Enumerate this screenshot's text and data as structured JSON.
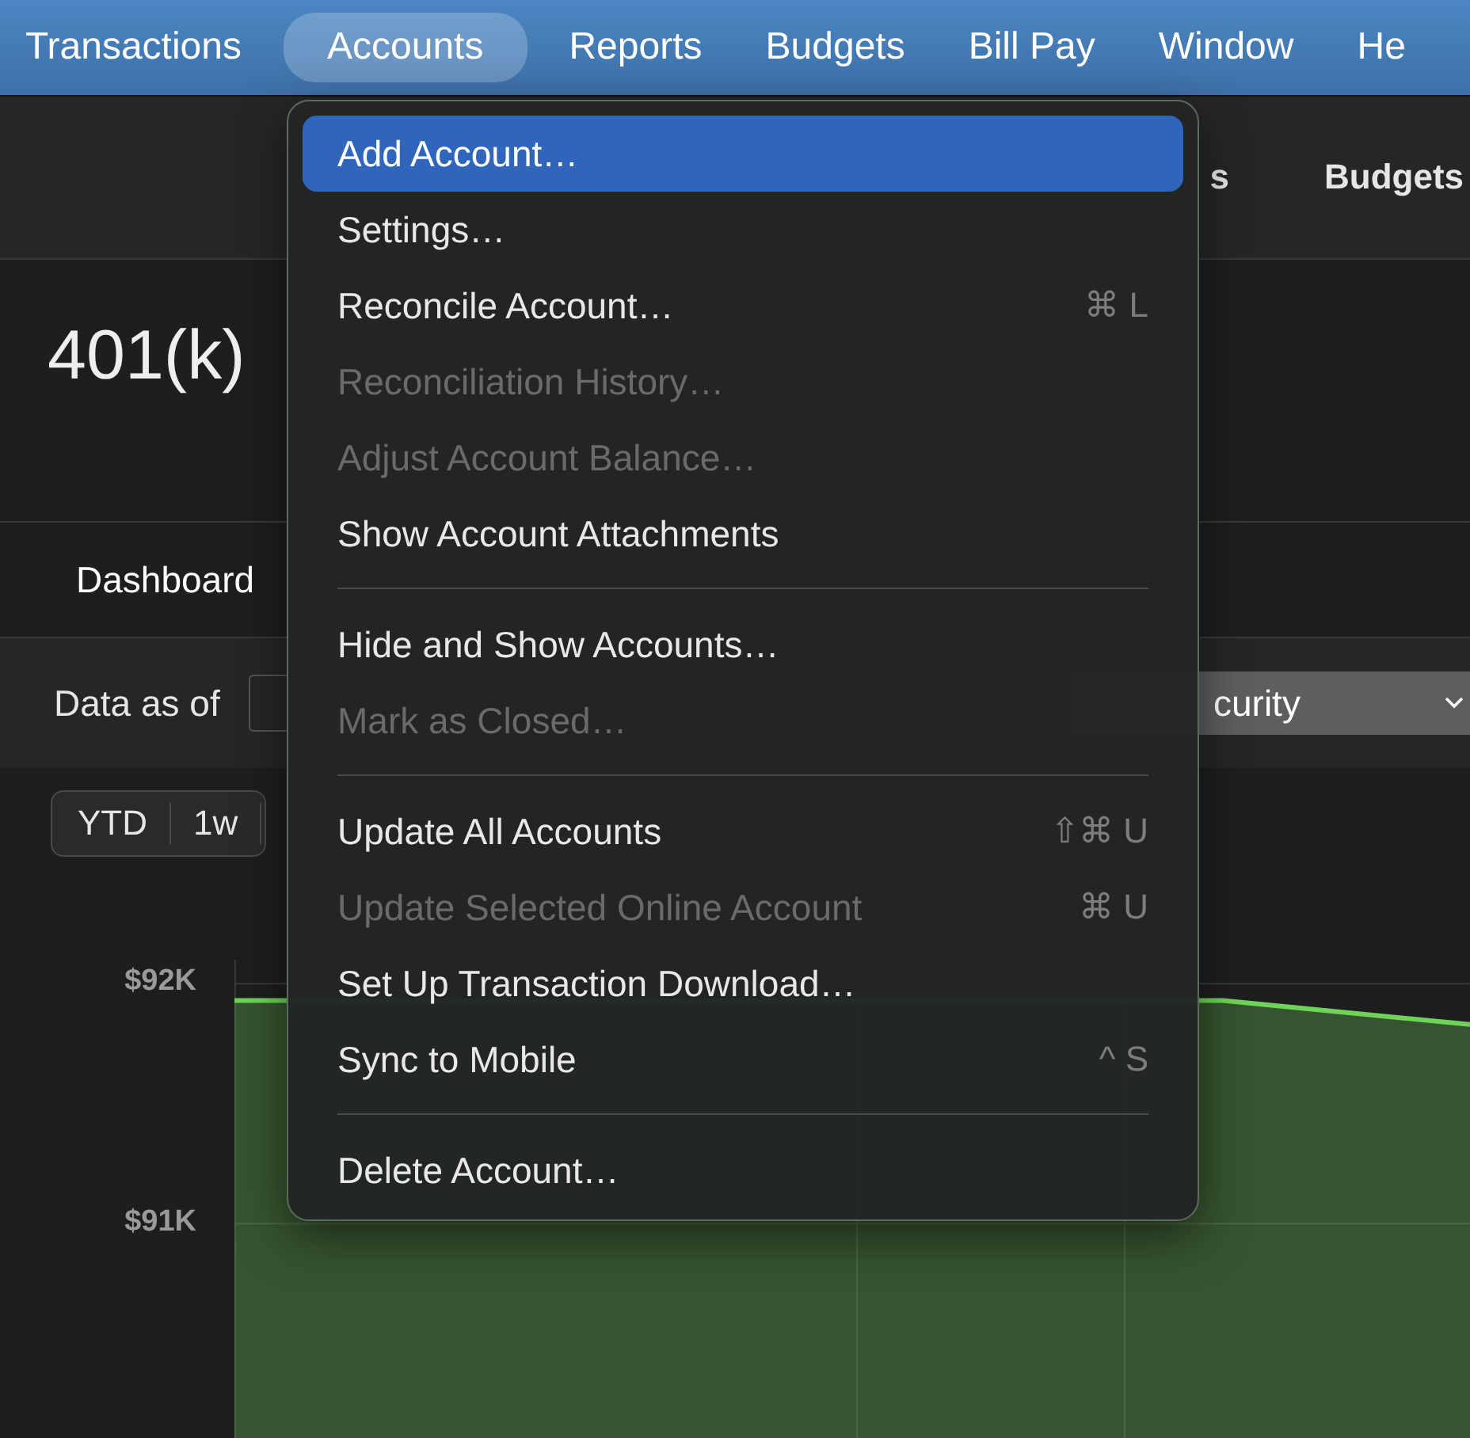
{
  "menu_bar": {
    "items": [
      {
        "label": "Transactions",
        "selected": false
      },
      {
        "label": "Accounts",
        "selected": true
      },
      {
        "label": "Reports",
        "selected": false
      },
      {
        "label": "Budgets",
        "selected": false
      },
      {
        "label": "Bill Pay",
        "selected": false
      },
      {
        "label": "Window",
        "selected": false
      },
      {
        "label": "He",
        "selected": false
      }
    ]
  },
  "toolbar": {
    "items": [
      "s",
      "Budgets"
    ]
  },
  "account": {
    "title": "401(k)"
  },
  "tabs": [
    {
      "label": "Dashboard",
      "selected": true
    }
  ],
  "filter": {
    "label": "Data as of",
    "popup": "curity"
  },
  "range_buttons": [
    {
      "label": "YTD",
      "selected": false
    },
    {
      "label": "1w",
      "selected": false
    }
  ],
  "chart": {
    "chart_data": {
      "type": "area",
      "yticks": [
        {
          "value": 92000,
          "label": "$92K"
        },
        {
          "value": 91000,
          "label": "$91K"
        }
      ],
      "ylim": [
        90100,
        92100
      ],
      "series": [
        {
          "color": "#6fd35a",
          "values": [
            91930,
            null,
            null,
            null,
            91930,
            91830
          ]
        }
      ]
    }
  },
  "menu": {
    "items": [
      {
        "kind": "item",
        "label": "Add Account…",
        "disabled": false,
        "selected": true
      },
      {
        "kind": "item",
        "label": "Settings…",
        "disabled": false,
        "selected": false
      },
      {
        "kind": "item",
        "label": "Reconcile Account…",
        "shortcut": "⌘ L",
        "disabled": false,
        "selected": false
      },
      {
        "kind": "item",
        "label": "Reconciliation History…",
        "disabled": true,
        "selected": false
      },
      {
        "kind": "item",
        "label": "Adjust Account Balance…",
        "disabled": true,
        "selected": false
      },
      {
        "kind": "item",
        "label": "Show Account Attachments",
        "disabled": false,
        "selected": false
      },
      {
        "kind": "separator"
      },
      {
        "kind": "item",
        "label": "Hide and Show Accounts…",
        "disabled": false,
        "selected": false
      },
      {
        "kind": "item",
        "label": "Mark as Closed…",
        "disabled": true,
        "selected": false
      },
      {
        "kind": "separator"
      },
      {
        "kind": "item",
        "label": "Update All Accounts",
        "shortcut": "⇧⌘ U",
        "disabled": false,
        "selected": false
      },
      {
        "kind": "item",
        "label": "Update Selected Online Account",
        "shortcut": "⌘ U",
        "disabled": true,
        "selected": false
      },
      {
        "kind": "item",
        "label": "Set Up Transaction Download…",
        "disabled": false,
        "selected": false
      },
      {
        "kind": "item",
        "label": "Sync to Mobile",
        "shortcut": "^ S",
        "disabled": false,
        "selected": false
      },
      {
        "kind": "separator"
      },
      {
        "kind": "item",
        "label": "Delete Account…",
        "disabled": false,
        "selected": false
      }
    ]
  }
}
